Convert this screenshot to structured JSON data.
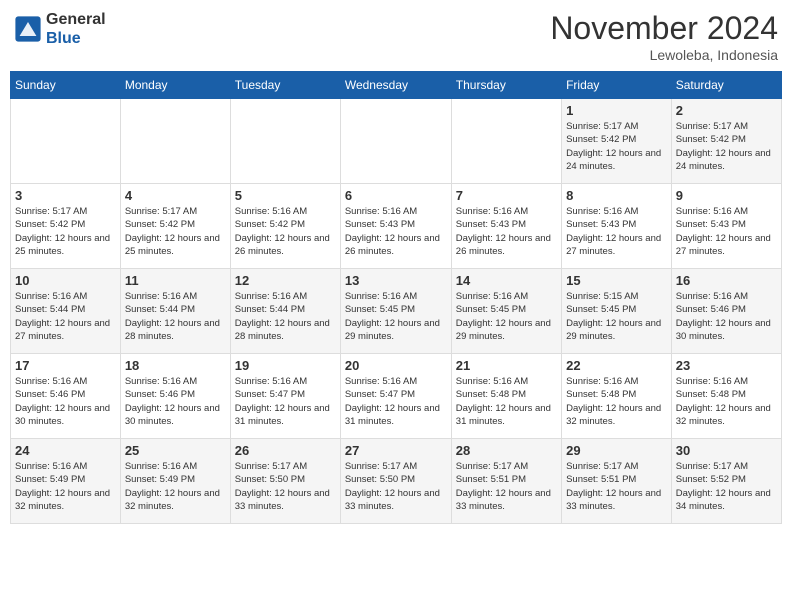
{
  "header": {
    "logo_line1": "General",
    "logo_line2": "Blue",
    "month_title": "November 2024",
    "location": "Lewoleba, Indonesia"
  },
  "weekdays": [
    "Sunday",
    "Monday",
    "Tuesday",
    "Wednesday",
    "Thursday",
    "Friday",
    "Saturday"
  ],
  "weeks": [
    [
      {
        "day": "",
        "sunrise": "",
        "sunset": "",
        "daylight": ""
      },
      {
        "day": "",
        "sunrise": "",
        "sunset": "",
        "daylight": ""
      },
      {
        "day": "",
        "sunrise": "",
        "sunset": "",
        "daylight": ""
      },
      {
        "day": "",
        "sunrise": "",
        "sunset": "",
        "daylight": ""
      },
      {
        "day": "",
        "sunrise": "",
        "sunset": "",
        "daylight": ""
      },
      {
        "day": "1",
        "sunrise": "5:17 AM",
        "sunset": "5:42 PM",
        "daylight": "12 hours and 24 minutes."
      },
      {
        "day": "2",
        "sunrise": "5:17 AM",
        "sunset": "5:42 PM",
        "daylight": "12 hours and 24 minutes."
      }
    ],
    [
      {
        "day": "3",
        "sunrise": "5:17 AM",
        "sunset": "5:42 PM",
        "daylight": "12 hours and 25 minutes."
      },
      {
        "day": "4",
        "sunrise": "5:17 AM",
        "sunset": "5:42 PM",
        "daylight": "12 hours and 25 minutes."
      },
      {
        "day": "5",
        "sunrise": "5:16 AM",
        "sunset": "5:42 PM",
        "daylight": "12 hours and 26 minutes."
      },
      {
        "day": "6",
        "sunrise": "5:16 AM",
        "sunset": "5:43 PM",
        "daylight": "12 hours and 26 minutes."
      },
      {
        "day": "7",
        "sunrise": "5:16 AM",
        "sunset": "5:43 PM",
        "daylight": "12 hours and 26 minutes."
      },
      {
        "day": "8",
        "sunrise": "5:16 AM",
        "sunset": "5:43 PM",
        "daylight": "12 hours and 27 minutes."
      },
      {
        "day": "9",
        "sunrise": "5:16 AM",
        "sunset": "5:43 PM",
        "daylight": "12 hours and 27 minutes."
      }
    ],
    [
      {
        "day": "10",
        "sunrise": "5:16 AM",
        "sunset": "5:44 PM",
        "daylight": "12 hours and 27 minutes."
      },
      {
        "day": "11",
        "sunrise": "5:16 AM",
        "sunset": "5:44 PM",
        "daylight": "12 hours and 28 minutes."
      },
      {
        "day": "12",
        "sunrise": "5:16 AM",
        "sunset": "5:44 PM",
        "daylight": "12 hours and 28 minutes."
      },
      {
        "day": "13",
        "sunrise": "5:16 AM",
        "sunset": "5:45 PM",
        "daylight": "12 hours and 29 minutes."
      },
      {
        "day": "14",
        "sunrise": "5:16 AM",
        "sunset": "5:45 PM",
        "daylight": "12 hours and 29 minutes."
      },
      {
        "day": "15",
        "sunrise": "5:15 AM",
        "sunset": "5:45 PM",
        "daylight": "12 hours and 29 minutes."
      },
      {
        "day": "16",
        "sunrise": "5:16 AM",
        "sunset": "5:46 PM",
        "daylight": "12 hours and 30 minutes."
      }
    ],
    [
      {
        "day": "17",
        "sunrise": "5:16 AM",
        "sunset": "5:46 PM",
        "daylight": "12 hours and 30 minutes."
      },
      {
        "day": "18",
        "sunrise": "5:16 AM",
        "sunset": "5:46 PM",
        "daylight": "12 hours and 30 minutes."
      },
      {
        "day": "19",
        "sunrise": "5:16 AM",
        "sunset": "5:47 PM",
        "daylight": "12 hours and 31 minutes."
      },
      {
        "day": "20",
        "sunrise": "5:16 AM",
        "sunset": "5:47 PM",
        "daylight": "12 hours and 31 minutes."
      },
      {
        "day": "21",
        "sunrise": "5:16 AM",
        "sunset": "5:48 PM",
        "daylight": "12 hours and 31 minutes."
      },
      {
        "day": "22",
        "sunrise": "5:16 AM",
        "sunset": "5:48 PM",
        "daylight": "12 hours and 32 minutes."
      },
      {
        "day": "23",
        "sunrise": "5:16 AM",
        "sunset": "5:48 PM",
        "daylight": "12 hours and 32 minutes."
      }
    ],
    [
      {
        "day": "24",
        "sunrise": "5:16 AM",
        "sunset": "5:49 PM",
        "daylight": "12 hours and 32 minutes."
      },
      {
        "day": "25",
        "sunrise": "5:16 AM",
        "sunset": "5:49 PM",
        "daylight": "12 hours and 32 minutes."
      },
      {
        "day": "26",
        "sunrise": "5:17 AM",
        "sunset": "5:50 PM",
        "daylight": "12 hours and 33 minutes."
      },
      {
        "day": "27",
        "sunrise": "5:17 AM",
        "sunset": "5:50 PM",
        "daylight": "12 hours and 33 minutes."
      },
      {
        "day": "28",
        "sunrise": "5:17 AM",
        "sunset": "5:51 PM",
        "daylight": "12 hours and 33 minutes."
      },
      {
        "day": "29",
        "sunrise": "5:17 AM",
        "sunset": "5:51 PM",
        "daylight": "12 hours and 33 minutes."
      },
      {
        "day": "30",
        "sunrise": "5:17 AM",
        "sunset": "5:52 PM",
        "daylight": "12 hours and 34 minutes."
      }
    ]
  ]
}
